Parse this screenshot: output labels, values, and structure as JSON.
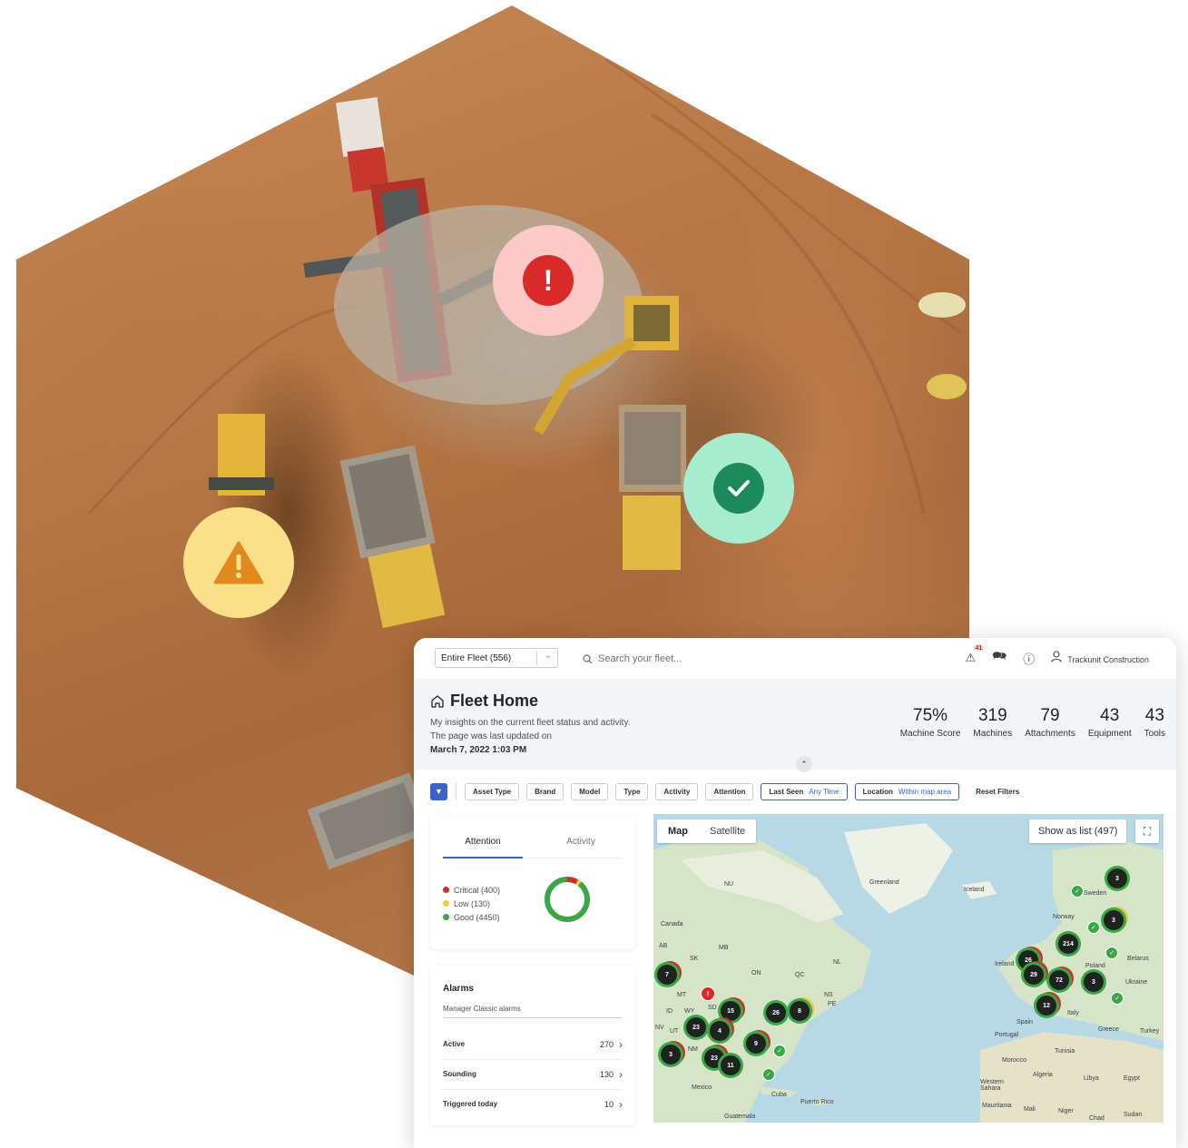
{
  "hero": {
    "status_icons": [
      "exclamation-icon",
      "checkmark-icon",
      "warning-triangle-icon"
    ],
    "colors": {
      "critical": "#d92a2a",
      "good": "#1d8a5b",
      "warning": "#e08a1e"
    }
  },
  "topbar": {
    "fleet_select": "Entire Fleet (556)",
    "search_placeholder": "Search your fleet...",
    "alert_count": "41",
    "user_name": "Trackunit Construction"
  },
  "header": {
    "title": "Fleet Home",
    "subtitle_line1": "My insights on the current fleet status and activity.",
    "subtitle_line2": "The page was last updated on",
    "updated_at": "March 7, 2022 1:03 PM",
    "stats": [
      {
        "value": "75%",
        "label": "Machine Score"
      },
      {
        "value": "319",
        "label": "Machines"
      },
      {
        "value": "79",
        "label": "Attachments"
      },
      {
        "value": "43",
        "label": "Equipment"
      },
      {
        "value": "43",
        "label": "Tools"
      }
    ]
  },
  "filters": {
    "chips": [
      "Asset Type",
      "Brand",
      "Model",
      "Type",
      "Activity",
      "Attention"
    ],
    "last_seen_label": "Last Seen",
    "last_seen_value": "Any Time",
    "location_label": "Location",
    "location_value": "Within map area",
    "reset": "Reset Filters",
    "accent": "#3a63c9"
  },
  "attention": {
    "tabs": [
      "Attention",
      "Activity"
    ],
    "active_tab": "Attention",
    "legend": [
      {
        "label": "Critical (400)",
        "color": "#c83228",
        "value": 400
      },
      {
        "label": "Low (130)",
        "color": "#f2cc3c",
        "value": 130
      },
      {
        "label": "Good (4450)",
        "color": "#3aa646",
        "value": 4450
      }
    ]
  },
  "alarms": {
    "title": "Alarms",
    "subtitle": "Manager Classic alarms",
    "rows": [
      {
        "name": "Active",
        "count": "270"
      },
      {
        "name": "Sounding",
        "count": "130"
      },
      {
        "name": "Triggered today",
        "count": "10"
      }
    ]
  },
  "map": {
    "toggle": [
      "Map",
      "Satellite"
    ],
    "active_view": "Map",
    "list_button": "Show as list (497)",
    "labels": [
      "Greenland",
      "Iceland",
      "NU",
      "Canada",
      "Sweden",
      "Norway",
      "Ireland",
      "Poland",
      "Belarus",
      "Ukraine",
      "Italy",
      "Spain",
      "Portugal",
      "Greece",
      "Turkey",
      "Morocco",
      "Tunisia",
      "Algeria",
      "Libya",
      "Egypt",
      "Western Sahara",
      "Mauritania",
      "Mali",
      "Niger",
      "Chad",
      "Sudan",
      "Mexico",
      "Cuba",
      "Puerto Rico",
      "Guatemala",
      "AB",
      "SK",
      "MB",
      "ON",
      "QC",
      "NL",
      "MT",
      "WY",
      "ID",
      "NV",
      "UT",
      "NM",
      "SD",
      "NS",
      "PE"
    ],
    "clusters": [
      "7",
      "15",
      "23",
      "4",
      "26",
      "8",
      "9",
      "3",
      "23",
      "11",
      "3",
      "3",
      "214",
      "26",
      "29",
      "72",
      "3",
      "12"
    ]
  }
}
